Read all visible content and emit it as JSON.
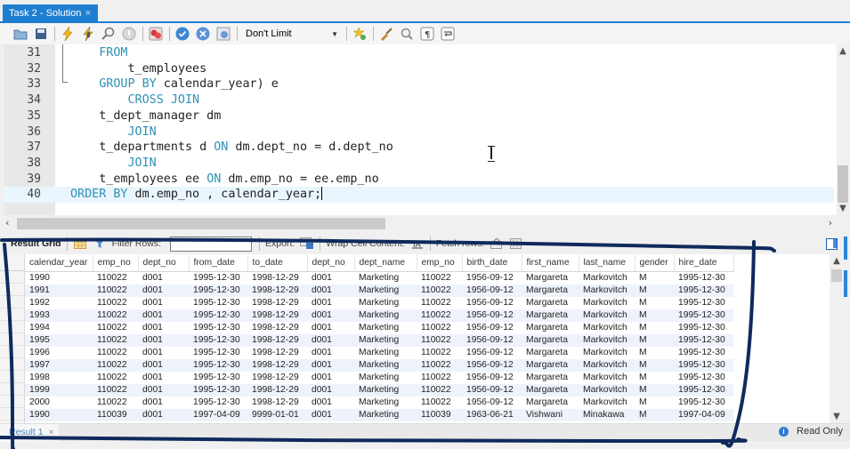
{
  "tab": {
    "title": "Task 2 - Solution",
    "close_glyph": "×"
  },
  "toolbar": {
    "icons": [
      "open-folder-icon",
      "save-icon",
      "execute-icon",
      "execute-current-icon",
      "explain-icon",
      "stop-icon",
      "toggle-error-icon",
      "commit-icon",
      "rollback-icon",
      "autocommit-icon",
      "bookmark-add-icon",
      "beautify-icon",
      "find-icon",
      "invisible-chars-icon",
      "word-wrap-icon"
    ],
    "limit_select": "Don't Limit"
  },
  "editor": {
    "lines": [
      {
        "num": "31",
        "segments": [
          {
            "t": "    ",
            "k": false
          },
          {
            "t": "FROM",
            "k": true
          }
        ]
      },
      {
        "num": "32",
        "segments": [
          {
            "t": "        t_employees",
            "k": false
          }
        ]
      },
      {
        "num": "33",
        "segments": [
          {
            "t": "    ",
            "k": false
          },
          {
            "t": "GROUP BY",
            "k": true
          },
          {
            "t": " calendar_year) e",
            "k": false
          }
        ]
      },
      {
        "num": "34",
        "segments": [
          {
            "t": "        ",
            "k": false
          },
          {
            "t": "CROSS JOIN",
            "k": true
          }
        ]
      },
      {
        "num": "35",
        "segments": [
          {
            "t": "    t_dept_manager dm",
            "k": false
          }
        ]
      },
      {
        "num": "36",
        "segments": [
          {
            "t": "        ",
            "k": false
          },
          {
            "t": "JOIN",
            "k": true
          }
        ]
      },
      {
        "num": "37",
        "segments": [
          {
            "t": "    t_departments d ",
            "k": false
          },
          {
            "t": "ON",
            "k": true
          },
          {
            "t": " dm.dept_no = d.dept_no",
            "k": false
          }
        ]
      },
      {
        "num": "38",
        "segments": [
          {
            "t": "        ",
            "k": false
          },
          {
            "t": "JOIN",
            "k": true
          }
        ]
      },
      {
        "num": "39",
        "segments": [
          {
            "t": "    t_employees ee ",
            "k": false
          },
          {
            "t": "ON",
            "k": true
          },
          {
            "t": " dm.emp_no = ee.emp_no",
            "k": false
          }
        ]
      },
      {
        "num": "40",
        "segments": [
          {
            "t": "ORDER BY",
            "k": true
          },
          {
            "t": " dm.emp_no , calendar_year;",
            "k": false
          }
        ],
        "current": true
      }
    ]
  },
  "result_toolbar": {
    "result_grid_label": "Result Grid",
    "filter_rows_label": "Filter Rows:",
    "filter_value": "",
    "export_label": "Export:",
    "wrap_label": "Wrap Cell Content:",
    "fetch_label": "Fetch rows:"
  },
  "grid": {
    "columns": [
      "calendar_year",
      "emp_no",
      "dept_no",
      "from_date",
      "to_date",
      "dept_no",
      "dept_name",
      "emp_no",
      "birth_date",
      "first_name",
      "last_name",
      "gender",
      "hire_date"
    ],
    "rows": [
      [
        "1990",
        "110022",
        "d001",
        "1995-12-30",
        "1998-12-29",
        "d001",
        "Marketing",
        "110022",
        "1956-09-12",
        "Margareta",
        "Markovitch",
        "M",
        "1995-12-30"
      ],
      [
        "1991",
        "110022",
        "d001",
        "1995-12-30",
        "1998-12-29",
        "d001",
        "Marketing",
        "110022",
        "1956-09-12",
        "Margareta",
        "Markovitch",
        "M",
        "1995-12-30"
      ],
      [
        "1992",
        "110022",
        "d001",
        "1995-12-30",
        "1998-12-29",
        "d001",
        "Marketing",
        "110022",
        "1956-09-12",
        "Margareta",
        "Markovitch",
        "M",
        "1995-12-30"
      ],
      [
        "1993",
        "110022",
        "d001",
        "1995-12-30",
        "1998-12-29",
        "d001",
        "Marketing",
        "110022",
        "1956-09-12",
        "Margareta",
        "Markovitch",
        "M",
        "1995-12-30"
      ],
      [
        "1994",
        "110022",
        "d001",
        "1995-12-30",
        "1998-12-29",
        "d001",
        "Marketing",
        "110022",
        "1956-09-12",
        "Margareta",
        "Markovitch",
        "M",
        "1995-12-30"
      ],
      [
        "1995",
        "110022",
        "d001",
        "1995-12-30",
        "1998-12-29",
        "d001",
        "Marketing",
        "110022",
        "1956-09-12",
        "Margareta",
        "Markovitch",
        "M",
        "1995-12-30"
      ],
      [
        "1996",
        "110022",
        "d001",
        "1995-12-30",
        "1998-12-29",
        "d001",
        "Marketing",
        "110022",
        "1956-09-12",
        "Margareta",
        "Markovitch",
        "M",
        "1995-12-30"
      ],
      [
        "1997",
        "110022",
        "d001",
        "1995-12-30",
        "1998-12-29",
        "d001",
        "Marketing",
        "110022",
        "1956-09-12",
        "Margareta",
        "Markovitch",
        "M",
        "1995-12-30"
      ],
      [
        "1998",
        "110022",
        "d001",
        "1995-12-30",
        "1998-12-29",
        "d001",
        "Marketing",
        "110022",
        "1956-09-12",
        "Margareta",
        "Markovitch",
        "M",
        "1995-12-30"
      ],
      [
        "1999",
        "110022",
        "d001",
        "1995-12-30",
        "1998-12-29",
        "d001",
        "Marketing",
        "110022",
        "1956-09-12",
        "Margareta",
        "Markovitch",
        "M",
        "1995-12-30"
      ],
      [
        "2000",
        "110022",
        "d001",
        "1995-12-30",
        "1998-12-29",
        "d001",
        "Marketing",
        "110022",
        "1956-09-12",
        "Margareta",
        "Markovitch",
        "M",
        "1995-12-30"
      ],
      [
        "1990",
        "110039",
        "d001",
        "1997-04-09",
        "9999-01-01",
        "d001",
        "Marketing",
        "110039",
        "1963-06-21",
        "Vishwani",
        "Minakawa",
        "M",
        "1997-04-09"
      ]
    ]
  },
  "bottom": {
    "result_tab": "Result 1",
    "result_tab_close": "×",
    "status": "Read Only"
  },
  "colors": {
    "accent": "#1e7fd0",
    "keyword": "#2e91b4",
    "annotation": "#0f2a5c"
  }
}
